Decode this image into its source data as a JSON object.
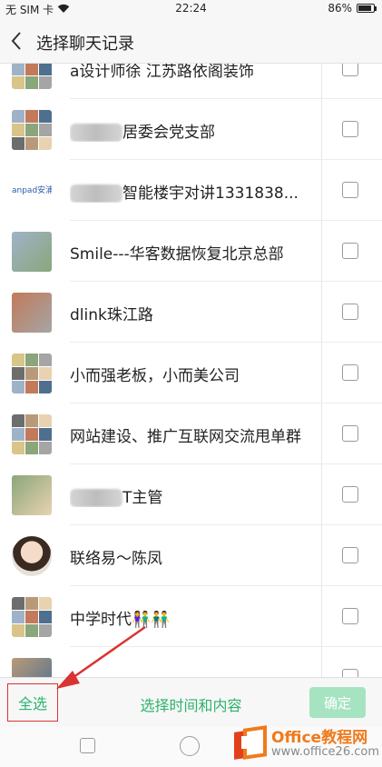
{
  "status_bar": {
    "carrier": "无 SIM 卡",
    "time": "22:24",
    "battery": "86%",
    "battery_level": 0.86,
    "wifi_icon": "wifi-icon"
  },
  "header": {
    "title": "选择聊天记录",
    "back_icon": "chevron-left-icon"
  },
  "chats": [
    {
      "name": "a设计师徐    江苏路依阁装饰",
      "avatar": "grid"
    },
    {
      "name": "居委会党支部",
      "avatar": "grid",
      "name_prefix_obscured": true
    },
    {
      "name": "智能楼宇对讲1331838...",
      "avatar": "logo",
      "name_prefix_obscured": true,
      "logo_text": "anpad安浦"
    },
    {
      "name": "Smile---华客数据恢复北京总部",
      "avatar": "photo"
    },
    {
      "name": "dlink珠江路",
      "avatar": "photo"
    },
    {
      "name": "小而强老板，小而美公司",
      "avatar": "grid"
    },
    {
      "name": "网站建设、推广互联网交流甩单群",
      "avatar": "grid"
    },
    {
      "name": "T主管",
      "avatar": "photo",
      "name_prefix_obscured": true
    },
    {
      "name": "联络易～陈凤",
      "avatar": "round"
    },
    {
      "name": "中学时代",
      "avatar": "grid",
      "emoji": "👫👬"
    },
    {
      "name": "",
      "avatar": "photo"
    }
  ],
  "bottom_bar": {
    "select_all": "全选",
    "select_time": "选择时间和内容",
    "confirm": "确定"
  },
  "watermark": {
    "title": "Office教程网",
    "url": "www.office26.com"
  },
  "colors": {
    "accent": "#2db36d",
    "highlight_box": "#d93333",
    "arrow": "#d93333",
    "confirm_bg": "#a6e4c1"
  }
}
